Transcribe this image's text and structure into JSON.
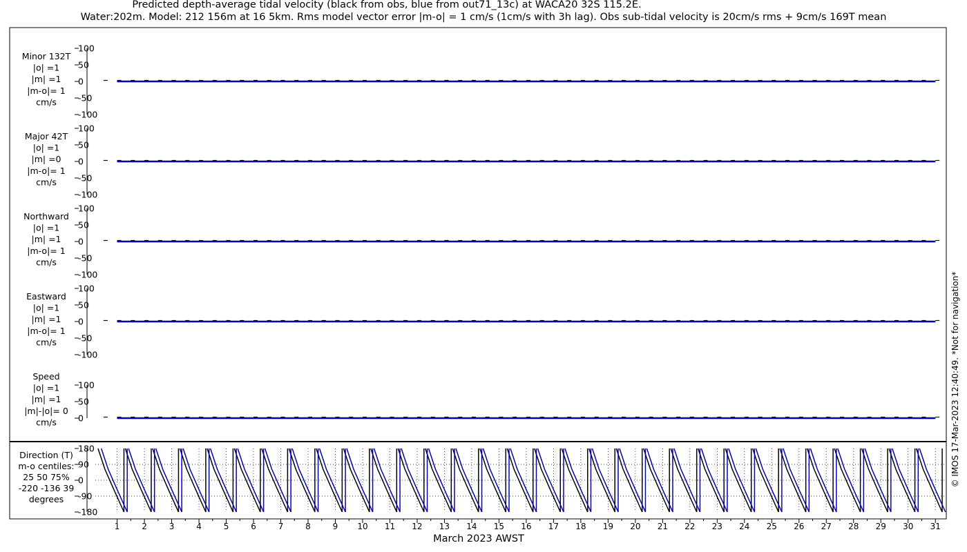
{
  "title_line1": "Predicted depth-average tidal velocity (black from obs, blue from out71_13c) at WACA20 32S 115.2E.",
  "title_line2": "Water:202m. Model: 212 156m at 16 5km. Rms model vector error |m-o| = 1 cm/s (1cm/s with 3h lag). Obs sub-tidal velocity is 20cm/s rms + 9cm/s 169T mean",
  "side_note": "© IMOS 17-Mar-2023 12:40:49. *Not for navigation*",
  "xlabel": "March 2023 AWST",
  "colors": {
    "obs": "#000000",
    "model": "#0000cc",
    "axis": "#000000",
    "grid": "#000000"
  },
  "chart_data": [
    {
      "type": "line",
      "panel": "Minor 132T",
      "stats": [
        "Minor 132T",
        "|o| =1",
        "|m| =1",
        "|m-o|= 1",
        "cm/s"
      ],
      "x": [
        1,
        16,
        31
      ],
      "series": [
        {
          "name": "obs",
          "values": [
            0,
            0,
            0
          ]
        },
        {
          "name": "model",
          "values": [
            0,
            0,
            0
          ]
        }
      ],
      "ylim": [
        -100,
        100
      ],
      "yticks": [
        100,
        50,
        0,
        -50,
        -100
      ]
    },
    {
      "type": "line",
      "panel": "Major 42T",
      "stats": [
        "Major 42T",
        "|o| =1",
        "|m| =0",
        "|m-o|= 1",
        "cm/s"
      ],
      "x": [
        1,
        16,
        31
      ],
      "series": [
        {
          "name": "obs",
          "values": [
            0,
            0,
            0
          ]
        },
        {
          "name": "model",
          "values": [
            0,
            0,
            0
          ]
        }
      ],
      "ylim": [
        -100,
        100
      ],
      "yticks": [
        100,
        50,
        0,
        -50,
        -100
      ]
    },
    {
      "type": "line",
      "panel": "Northward",
      "stats": [
        "Northward",
        "|o| =1",
        "|m| =1",
        "|m-o|= 1",
        "cm/s"
      ],
      "x": [
        1,
        16,
        31
      ],
      "series": [
        {
          "name": "obs",
          "values": [
            0,
            0,
            0
          ]
        },
        {
          "name": "model",
          "values": [
            0,
            0,
            0
          ]
        }
      ],
      "ylim": [
        -100,
        100
      ],
      "yticks": [
        100,
        50,
        0,
        -50,
        -100
      ]
    },
    {
      "type": "line",
      "panel": "Eastward",
      "stats": [
        "Eastward",
        "|o| =1",
        "|m| =1",
        "|m-o|= 1",
        "cm/s"
      ],
      "x": [
        1,
        16,
        31
      ],
      "series": [
        {
          "name": "obs",
          "values": [
            0,
            0,
            0
          ]
        },
        {
          "name": "model",
          "values": [
            0,
            0,
            0
          ]
        }
      ],
      "ylim": [
        -100,
        100
      ],
      "yticks": [
        100,
        50,
        0,
        -50,
        -100
      ]
    },
    {
      "type": "line",
      "panel": "Speed",
      "stats": [
        "Speed",
        "|o| =1",
        "|m| =1",
        "|m|-|o|= 0",
        "cm/s"
      ],
      "x": [
        1,
        16,
        31
      ],
      "series": [
        {
          "name": "obs",
          "values": [
            0,
            0,
            0
          ]
        },
        {
          "name": "model",
          "values": [
            0,
            0,
            0
          ]
        }
      ],
      "ylim": [
        0,
        100
      ],
      "yticks": [
        100,
        50,
        0
      ]
    },
    {
      "type": "line",
      "panel": "Direction (T)",
      "stats": [
        "Direction (T)",
        "m-o centiles:",
        "25  50  75%",
        "-220 -136   39",
        "degrees"
      ],
      "x_start": 0.3,
      "step_days": 0.5,
      "series": [
        {
          "name": "obs",
          "wrap_values": [
            180,
            -180,
            180,
            -180,
            180,
            -180,
            180,
            -180,
            180,
            -180,
            180,
            -180,
            180,
            -180,
            180,
            -180,
            180,
            -180,
            180,
            -180,
            180,
            -180,
            180,
            -180,
            180,
            -180,
            180,
            -180,
            180,
            -180,
            180,
            -180,
            180,
            -180,
            180,
            -180,
            180,
            -180,
            180,
            -180,
            180,
            -180,
            180,
            -180,
            180,
            -180,
            180,
            -180,
            180,
            -180,
            180,
            -180,
            180,
            -180,
            180,
            -180,
            180,
            -180,
            180,
            -180,
            180,
            -180,
            180
          ]
        },
        {
          "name": "model",
          "wrap_values": [
            180,
            -180,
            180,
            -180,
            180,
            -180,
            180,
            -180,
            180,
            -180,
            180,
            -180,
            180,
            -180,
            180,
            -180,
            180,
            -180,
            180,
            -180,
            180,
            -180,
            180,
            -180,
            180,
            -180,
            180,
            -180,
            180,
            -180,
            180,
            -180,
            180,
            -180,
            180,
            -180,
            180,
            -180,
            180,
            -180,
            180,
            -180,
            180,
            -180,
            180,
            -180,
            180,
            -180,
            180,
            -180,
            180,
            -180,
            180,
            -180,
            180,
            -180,
            180,
            -180,
            180,
            -180,
            180,
            -180,
            180
          ]
        }
      ],
      "ylim": [
        -180,
        180
      ],
      "yticks": [
        180,
        90,
        0,
        -90,
        -180
      ]
    }
  ],
  "xaxis": {
    "ticks": [
      1,
      2,
      3,
      4,
      5,
      6,
      7,
      8,
      9,
      10,
      11,
      12,
      13,
      14,
      15,
      16,
      17,
      18,
      19,
      20,
      21,
      22,
      23,
      24,
      25,
      26,
      27,
      28,
      29,
      30,
      31
    ],
    "range": [
      0.2,
      31.4
    ]
  }
}
